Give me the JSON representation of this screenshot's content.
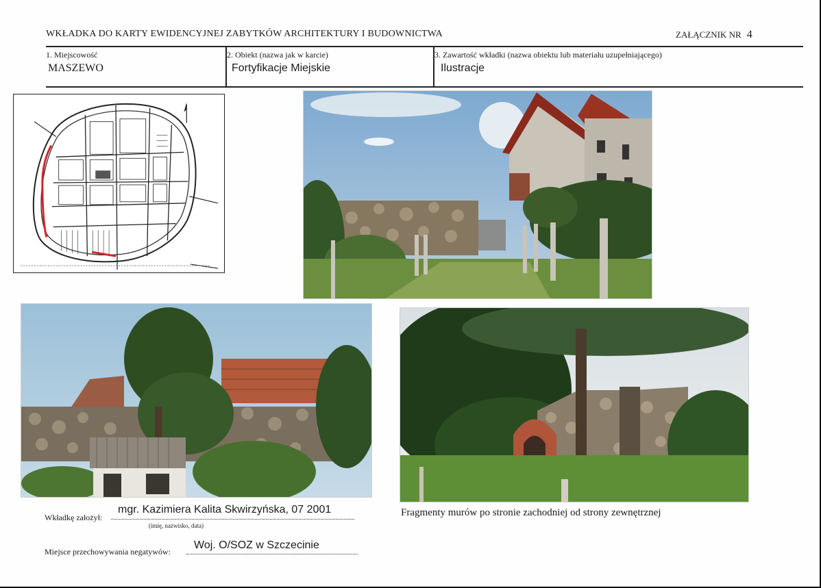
{
  "header": {
    "title": "WKŁADKA DO KARTY EWIDENCYJNEJ ZABYTKÓW ARCHITEKTURY I BUDOWNICTWA",
    "annex_label": "ZAŁĄCZNIK NR",
    "annex_number": "4"
  },
  "fields": {
    "locality": {
      "label": "1. Miejscowość",
      "value": "MASZEWO"
    },
    "object": {
      "label": "2. Obiekt (nazwa jak w karcie)",
      "value": "Fortyfikacje Miejskie"
    },
    "contents": {
      "label": "3. Zawartość wkładki (nazwa obiektu lub materiału uzupełniającego)",
      "value": "Ilustracje"
    }
  },
  "illustrations": {
    "map": {
      "icon": "town-plan-map-icon",
      "accent": "#d3242a"
    },
    "photo_top": {
      "icon": "house-and-stone-wall-photo"
    },
    "photo_bottom_left": {
      "icon": "stone-wall-with-brick-ruin-photo"
    },
    "photo_bottom_right": {
      "icon": "wall-with-brick-arch-photo"
    },
    "caption": "Fragmenty murów po stronie zachodniej od strony zewnętrznej"
  },
  "footer": {
    "author_label": "Wkładkę założył:",
    "author_value": "mgr. Kazimiera Kalita Skwirzyńska, 07 2001",
    "author_hint": "(imię, nazwisko, data)",
    "storage_label": "Miejsce przechowywania negatywów:",
    "storage_value": "Woj. O/SOZ w Szczecinie"
  }
}
